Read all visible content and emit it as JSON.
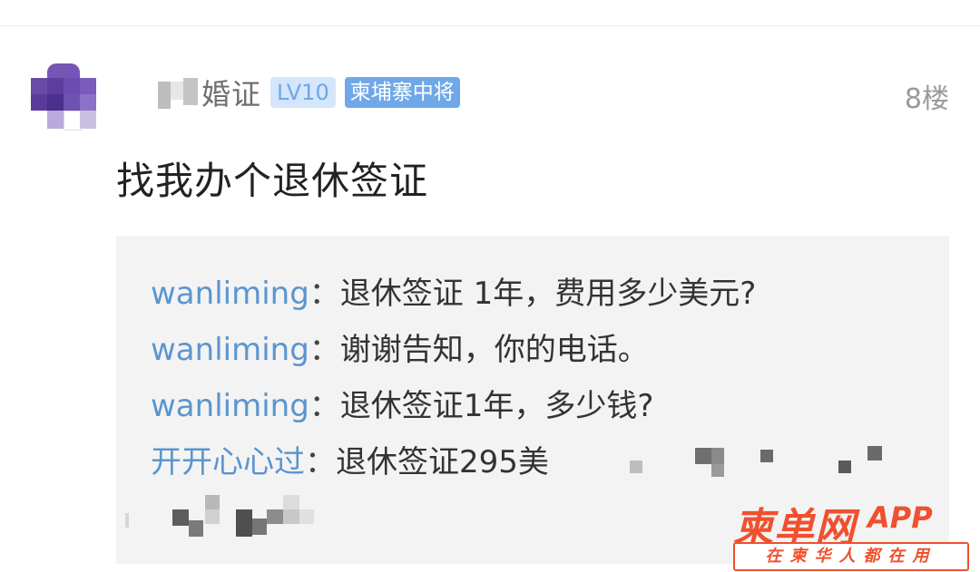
{
  "post": {
    "username": "婚证",
    "level_badge": "LV10",
    "rank_badge": "柬埔寨中将",
    "floor": "8楼",
    "content": "找我办个退休签证"
  },
  "replies": [
    {
      "user": "wanliming",
      "sep": "：",
      "text": "退休签证 1年，费用多少美元?"
    },
    {
      "user": "wanliming",
      "sep": "：",
      "text": "谢谢告知，你的电话。"
    },
    {
      "user": "wanliming",
      "sep": "：",
      "text": "退休签证1年，多少钱?"
    },
    {
      "user": "开开心心过",
      "sep": "：",
      "text": "退休签证295美"
    }
  ],
  "watermark": {
    "title": "柬单网",
    "app": "APP",
    "slogan": "在柬华人都在用"
  },
  "colors": {
    "reply_user": "#5b95cf",
    "level_badge_bg": "#d4e6fb",
    "rank_badge_bg": "#6fa8e8",
    "watermark": "#f0502e"
  },
  "icons": {
    "avatar": "avatar-icon"
  }
}
